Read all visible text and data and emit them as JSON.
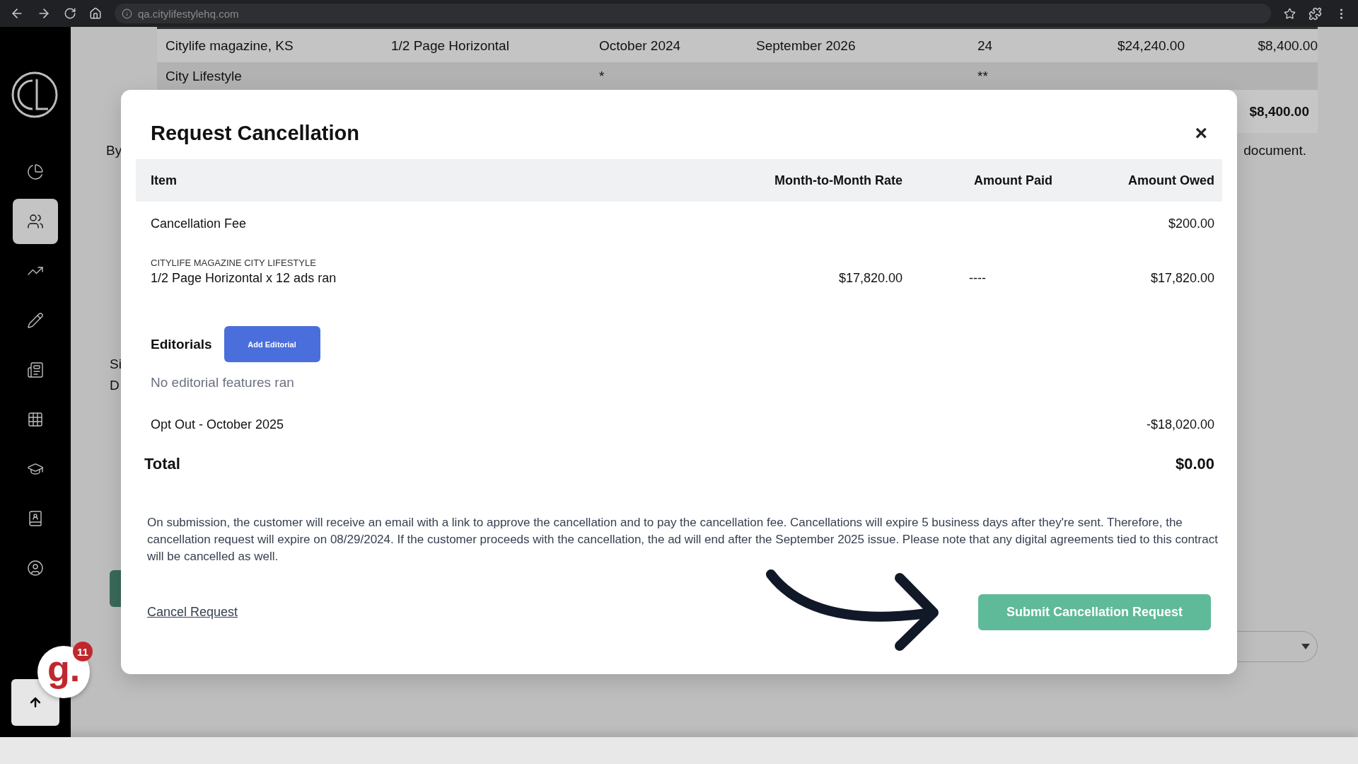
{
  "browser": {
    "url": "qa.citylifestylehq.com"
  },
  "sidebar": {
    "items": [
      {
        "kind": "pie",
        "selected": false
      },
      {
        "kind": "people",
        "selected": true
      },
      {
        "kind": "trend",
        "selected": false
      },
      {
        "kind": "pencil",
        "selected": false
      },
      {
        "kind": "news",
        "selected": false
      },
      {
        "kind": "grid",
        "selected": false
      },
      {
        "kind": "cap",
        "selected": false
      },
      {
        "kind": "contacts",
        "selected": false
      },
      {
        "kind": "user",
        "selected": false
      }
    ]
  },
  "background": {
    "table_rows": [
      [
        "Citylife magazine, KS",
        "1/2 Page Horizontal",
        "October 2024",
        "September 2026",
        "24",
        "$24,240.00",
        "$8,400.00"
      ],
      [
        "City Lifestyle",
        "",
        "*",
        "",
        "**",
        "",
        ""
      ]
    ],
    "total": "$8,400.00",
    "left_fragment": "By",
    "right_fragment": "document.",
    "fragments": [
      "Si",
      "D"
    ]
  },
  "modal": {
    "title": "Request Cancellation",
    "close": "×",
    "columns": [
      "Item",
      "Month-to-Month Rate",
      "Amount Paid",
      "Amount Owed"
    ],
    "rows": [
      {
        "item": "Cancellation Fee",
        "owed": "$200.00"
      },
      {
        "sublabel": "CITYLIFE MAGAZINE CITY LIFESTYLE",
        "item": "1/2 Page Horizontal x 12 ads ran",
        "rate": "$17,820.00",
        "paid": "----",
        "owed": "$17,820.00"
      }
    ],
    "editorials": {
      "label": "Editorials",
      "button": "Add Editorial",
      "empty": "No editorial features ran"
    },
    "opt_out": {
      "label": "Opt Out - October 2025",
      "amount": "-$18,020.00"
    },
    "total": {
      "label": "Total",
      "amount": "$0.00"
    },
    "note": "On submission, the customer will receive an email with a link to approve the cancellation and to pay the cancellation fee. Cancellations will expire 5 business days after they're sent. Therefore, the cancellation request will expire on 08/29/2024. If the customer proceeds with the cancellation, the ad will end after the September 2025 issue. Please note that any digital agreements tied to this contract will be cancelled as well.",
    "cancel_link": "Cancel Request",
    "submit": "Submit Cancellation Request"
  },
  "launcher": {
    "logo": "g.",
    "count": "11"
  }
}
